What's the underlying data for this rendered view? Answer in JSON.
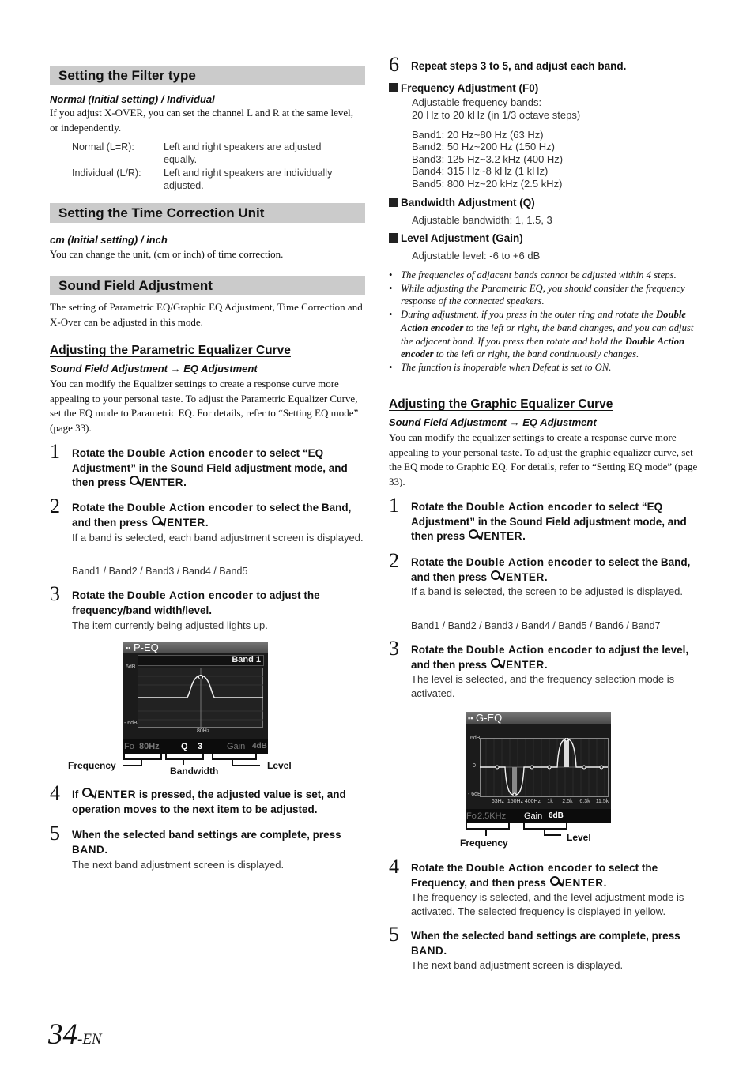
{
  "page": {
    "number": "34",
    "suffix": "-EN"
  },
  "filter_type": {
    "title": "Setting the Filter type",
    "options_line": "Normal (Initial setting) / Individual",
    "desc": "If you adjust X-OVER, you can set the channel L and R at the same level, or independently.",
    "defs": [
      {
        "term": "Normal (L=R):",
        "def": "Left and right speakers are adjusted equally."
      },
      {
        "term": "Individual (L/R):",
        "def": "Left and right speakers are individually adjusted."
      }
    ]
  },
  "time_correction": {
    "title": "Setting the Time Correction Unit",
    "options_line": "cm (Initial setting) / inch",
    "desc": "You can change the unit, (cm or inch) of time correction."
  },
  "sound_field": {
    "title": "Sound Field Adjustment",
    "desc": "The setting of Parametric EQ/Graphic EQ Adjustment, Time Correction and X-Over can be adjusted in this mode."
  },
  "peq": {
    "title": "Adjusting the Parametric Equalizer Curve",
    "path_a": "Sound Field Adjustment",
    "arrow": "→",
    "path_b": "EQ Adjustment",
    "desc": "You can modify the Equalizer settings to create a response curve more appealing to your personal taste. To adjust the Parametric Equalizer Curve, set the EQ mode to Parametric EQ. For details, refer to “Setting EQ mode” (page 33).",
    "steps": [
      {
        "num": "1",
        "pre": "Rotate the ",
        "bold": "Double Action encoder",
        "post": " to select “EQ Adjustment” in the Sound Field adjustment mode, and then press ",
        "key": "/ENTER",
        "end": "."
      },
      {
        "num": "2",
        "pre": "Rotate the ",
        "bold": "Double Action encoder",
        "post": " to select the Band, and then press ",
        "key": "/ENTER",
        "end": ".",
        "sub": "If a band is selected, each band adjustment screen is displayed.",
        "list": "Band1 / Band2 / Band3 / Band4 / Band5"
      },
      {
        "num": "3",
        "pre": "Rotate the ",
        "bold": "Double Action encoder",
        "post": " to adjust the frequency/band width/level.",
        "sub": "The item currently being adjusted lights up."
      },
      {
        "num": "4",
        "pre": "If ",
        "key": "/ENTER",
        "post": " is pressed, the adjusted value is set, and operation moves to the next item to be adjusted."
      },
      {
        "num": "5",
        "pre": "When the selected band settings are complete, press ",
        "key2": "BAND",
        "end": ".",
        "sub": "The next band adjustment screen is displayed."
      }
    ],
    "screen": {
      "title": "P-EQ",
      "band": "Band 1",
      "y_top": "6dB",
      "y_bottom": "- 6dB",
      "x_label": "80Hz",
      "fo_label": "Fo",
      "fo_value": "80Hz",
      "q_label": "Q",
      "q_value": "3",
      "gain_label": "Gain",
      "gain_value": "4dB"
    },
    "callouts": {
      "frequency": "Frequency",
      "bandwidth": "Bandwidth",
      "level": "Level"
    }
  },
  "right_top": {
    "step6": {
      "num": "6",
      "text": "Repeat steps 3 to 5, and adjust each band."
    },
    "freq_adj": {
      "title": "Frequency Adjustment (F0)",
      "line1": "Adjustable frequency bands:",
      "line2": "20 Hz to 20 kHz (in 1/3 octave steps)",
      "bands": [
        "Band1: 20 Hz~80 Hz (63 Hz)",
        "Band2: 50 Hz~200 Hz (150 Hz)",
        "Band3: 125 Hz~3.2 kHz (400 Hz)",
        "Band4: 315 Hz~8 kHz (1 kHz)",
        "Band5: 800 Hz~20 kHz (2.5 kHz)"
      ]
    },
    "bw_adj": {
      "title": "Bandwidth Adjustment (Q)",
      "text": "Adjustable bandwidth: 1, 1.5, 3"
    },
    "level_adj": {
      "title": "Level Adjustment (Gain)",
      "text": "Adjustable level: -6 to +6 dB"
    },
    "notes": {
      "n1": "The frequencies of adjacent bands cannot be adjusted within 4 steps.",
      "n2": "While adjusting the Parametric EQ, you should consider the frequency response of the connected speakers.",
      "n3a": "During adjustment, if you press in the outer ring and rotate the ",
      "n3b": "Double Action encoder",
      "n3c": " to the left or right, the band changes, and you can adjust the adjacent band. If you press then rotate and hold the ",
      "n3d": "Double Action encoder",
      "n3e": " to the left or right, the band continuously changes.",
      "n4": "The function is inoperable when Defeat is set to ON."
    }
  },
  "geq": {
    "title": "Adjusting the Graphic Equalizer Curve",
    "path_a": "Sound Field Adjustment",
    "arrow": "→",
    "path_b": "EQ Adjustment",
    "desc": "You can modify the equalizer settings to create a response curve more appealing to your personal taste. To adjust the graphic equalizer curve, set the EQ mode to Graphic EQ. For details, refer to “Setting EQ mode” (page 33).",
    "steps": [
      {
        "num": "1",
        "pre": "Rotate the ",
        "bold": "Double Action encoder",
        "post": " to select “EQ Adjustment” in the Sound Field adjustment mode, and then press ",
        "key": "/ENTER",
        "end": "."
      },
      {
        "num": "2",
        "pre": "Rotate the ",
        "bold": "Double Action encoder",
        "post": " to select the Band, and then press ",
        "key": "/ENTER",
        "end": ".",
        "sub": "If a band is selected, the screen to be adjusted is displayed.",
        "list": "Band1 / Band2 / Band3 / Band4 / Band5 / Band6 / Band7"
      },
      {
        "num": "3",
        "pre": "Rotate the ",
        "bold": "Double Action encoder",
        "post": " to adjust the level, and then press ",
        "key": "/ENTER",
        "end": ".",
        "sub": "The level is selected, and the frequency selection mode is activated."
      },
      {
        "num": "4",
        "pre": "Rotate the ",
        "bold": "Double Action encoder",
        "post": " to select the Frequency, and then press ",
        "key": "/ENTER",
        "end": ".",
        "sub": "The frequency is selected, and the level adjustment mode is activated. The selected frequency is displayed in yellow."
      },
      {
        "num": "5",
        "pre": "When the selected band settings are complete, press ",
        "key2": "BAND",
        "end": ".",
        "sub": "The next band adjustment screen is displayed."
      }
    ],
    "screen": {
      "title": "G-EQ",
      "y_top": "6dB",
      "y_mid": "0",
      "y_bottom": "- 6dB",
      "freqs": [
        "63Hz",
        "150Hz",
        "400Hz",
        "1k",
        "2.5k",
        "6.3k",
        "11.5k"
      ],
      "levels_db": [
        0,
        -6,
        0,
        0,
        6,
        0,
        0
      ],
      "fo_label": "Fo",
      "fo_value": "2.5KHz",
      "gain_label": "Gain",
      "gain_value": "6dB"
    },
    "callouts": {
      "frequency": "Frequency",
      "level": "Level"
    }
  }
}
